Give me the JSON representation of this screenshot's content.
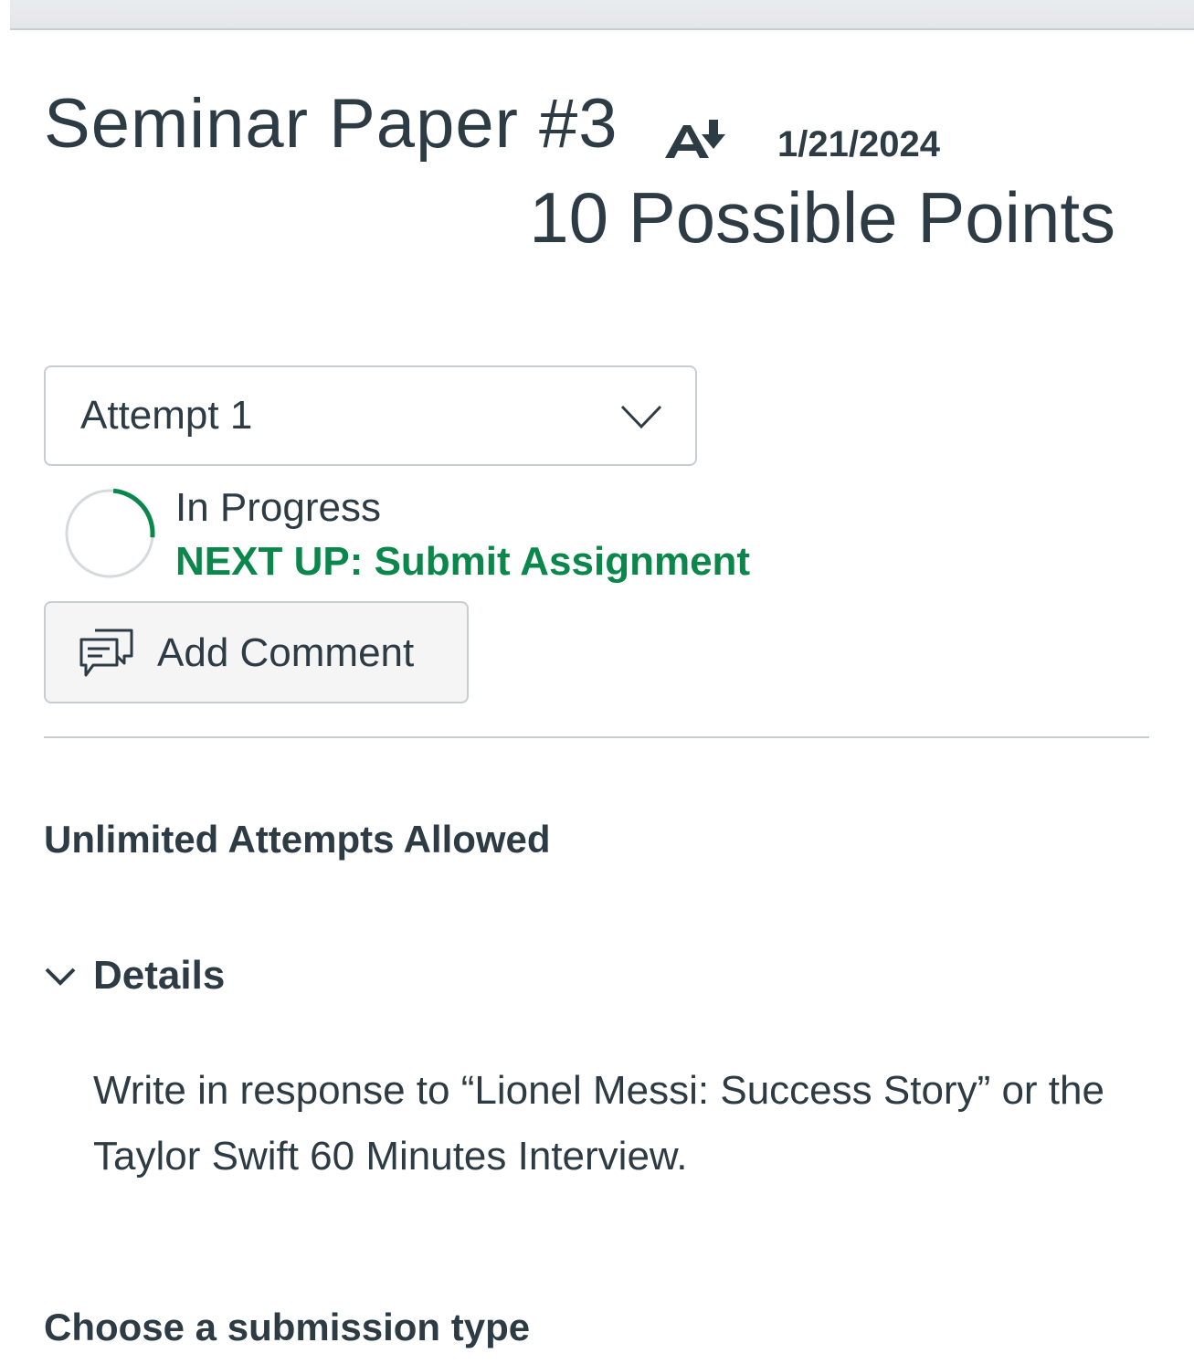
{
  "assignment": {
    "title": "Seminar Paper #3",
    "due_icon": "due-date-icon",
    "due_date": "1/21/2024",
    "points": "10 Possible Points"
  },
  "attempt_select": {
    "selected": "Attempt 1",
    "icon": "chevron-down-icon"
  },
  "status": {
    "progress_icon": "progress-ring-icon",
    "progress_fraction": 0.25,
    "label": "In Progress",
    "next_up": "NEXT UP: Submit Assignment",
    "accent_color": "#0b874b"
  },
  "comment_button": {
    "icon": "comment-icon",
    "label": "Add Comment"
  },
  "attempts_allowed": "Unlimited Attempts Allowed",
  "details": {
    "icon": "chevron-down-icon",
    "label": "Details",
    "body": "Write in response to “Lionel Messi: Success Story” or the Taylor Swift 60 Minutes Interview."
  },
  "submission_type_heading": "Choose a submission type",
  "colors": {
    "text": "#2d3b45",
    "border": "#c7cdd1",
    "success": "#0b874b"
  }
}
